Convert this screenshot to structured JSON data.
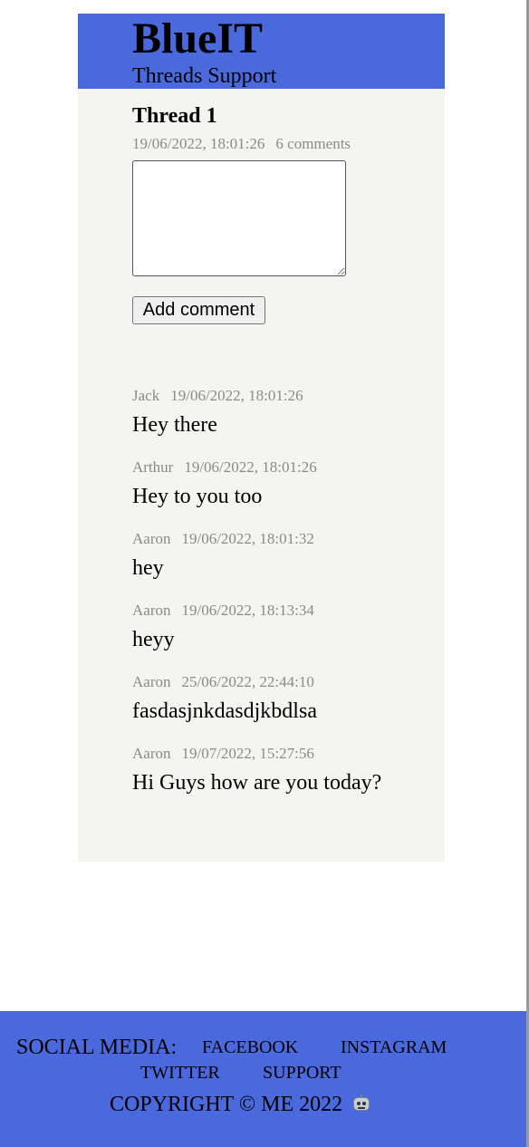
{
  "header": {
    "brand": "BlueIT",
    "subtitle": "Threads Support"
  },
  "thread": {
    "title": "Thread 1",
    "date": "19/06/2022, 18:01:26",
    "comment_count": "6 comments",
    "comment_input_value": "",
    "add_comment_label": "Add comment"
  },
  "comments": [
    {
      "author": "Jack",
      "date": "19/06/2022, 18:01:26",
      "text": "Hey there"
    },
    {
      "author": "Arthur",
      "date": "19/06/2022, 18:01:26",
      "text": "Hey to you too"
    },
    {
      "author": "Aaron",
      "date": "19/06/2022, 18:01:32",
      "text": "hey"
    },
    {
      "author": "Aaron",
      "date": "19/06/2022, 18:13:34",
      "text": "heyy"
    },
    {
      "author": "Aaron",
      "date": "25/06/2022, 22:44:10",
      "text": "fasdasjnkdasdjkbdlsa"
    },
    {
      "author": "Aaron",
      "date": "19/07/2022, 15:27:56",
      "text": "Hi Guys how are you today?"
    }
  ],
  "footer": {
    "social_label": "SOCIAL MEDIA:",
    "links": [
      "FACEBOOK",
      "INSTAGRAM",
      "TWITTER",
      "SUPPORT"
    ],
    "copyright": "COPYRIGHT © ME 2022",
    "copyright_icon": "robot-icon"
  },
  "colors": {
    "brand_blue": "#4a69dc",
    "panel_bg": "#f4f4f0",
    "meta_gray": "#8a8a8a"
  }
}
